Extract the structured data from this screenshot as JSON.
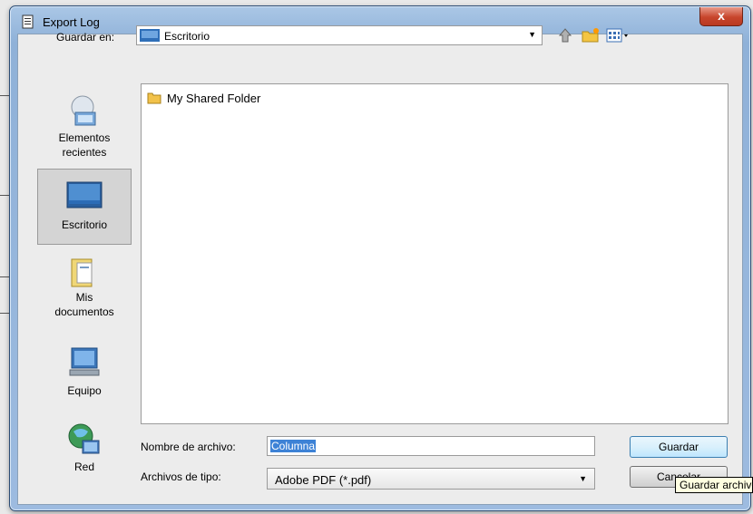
{
  "window": {
    "title": "Export Log",
    "close_label": "x"
  },
  "look_in": {
    "label": "Guardar en:",
    "value": "Escritorio"
  },
  "places": [
    {
      "label": "Elementos recientes",
      "icon": "recent-items-icon"
    },
    {
      "label": "Escritorio",
      "icon": "desktop-icon",
      "selected": true
    },
    {
      "label": "Mis documentos",
      "icon": "documents-icon"
    },
    {
      "label": "Equipo",
      "icon": "computer-icon"
    },
    {
      "label": "Red",
      "icon": "network-icon"
    }
  ],
  "files": [
    {
      "name": "My Shared Folder",
      "icon": "folder-icon"
    }
  ],
  "file_name": {
    "label": "Nombre de archivo:",
    "value": "Columna"
  },
  "file_type": {
    "label": "Archivos de tipo:",
    "value": "Adobe PDF (*.pdf)"
  },
  "buttons": {
    "save": "Guardar",
    "cancel": "Cancelar"
  },
  "tooltip": "Guardar archivo",
  "colors": {
    "accent": "#3d82d6",
    "close": "#c7452c",
    "frame": "#9dbbe0"
  }
}
